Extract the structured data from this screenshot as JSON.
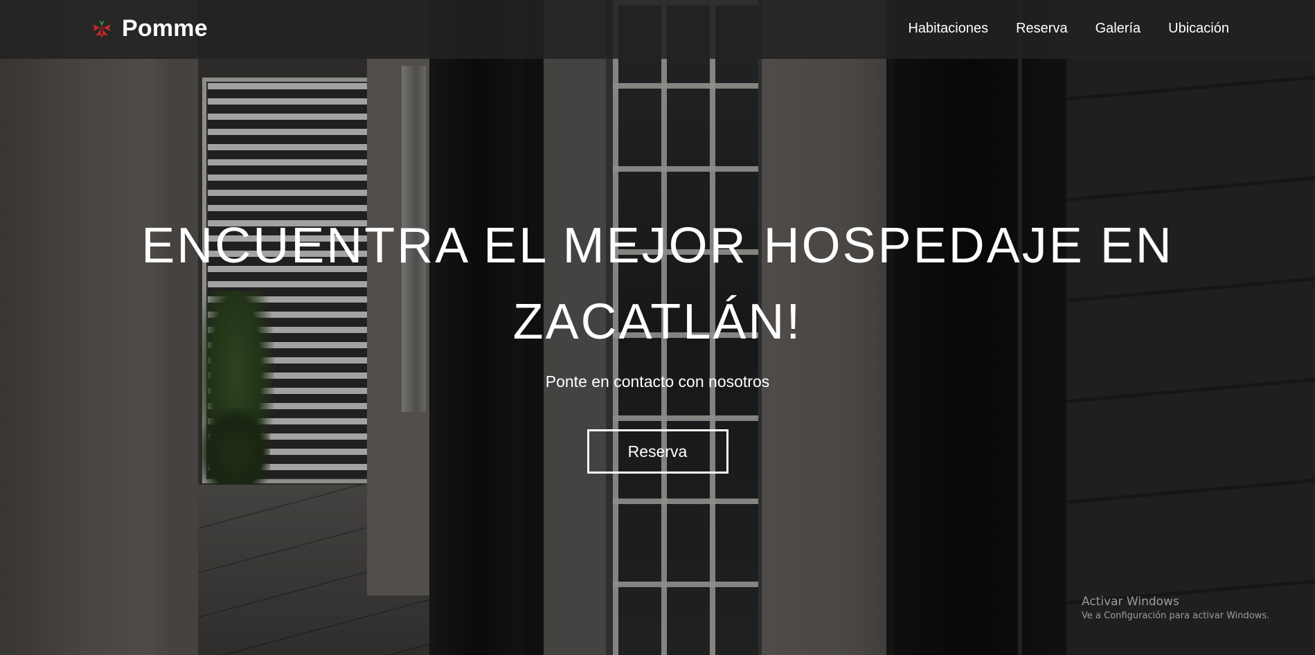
{
  "brand": {
    "name": "Pomme",
    "icon": "leaf-logo-icon"
  },
  "nav": {
    "items": [
      {
        "label": "Habitaciones"
      },
      {
        "label": "Reserva"
      },
      {
        "label": "Galería"
      },
      {
        "label": "Ubicación"
      }
    ]
  },
  "hero": {
    "title_line1": "ENCUENTRA EL MEJOR HOSPEDAJE EN",
    "title_line2": "ZACATLÁN!",
    "subtitle": "Ponte en contacto con nosotros",
    "button_label": "Reserva"
  },
  "watermark": {
    "title": "Activar Windows",
    "subtitle": "Ve a Configuración para activar Windows."
  },
  "colors": {
    "navbar": "#222222",
    "text": "#ffffff",
    "logo_red": "#d12a2a",
    "logo_green": "#2f8a3a"
  }
}
